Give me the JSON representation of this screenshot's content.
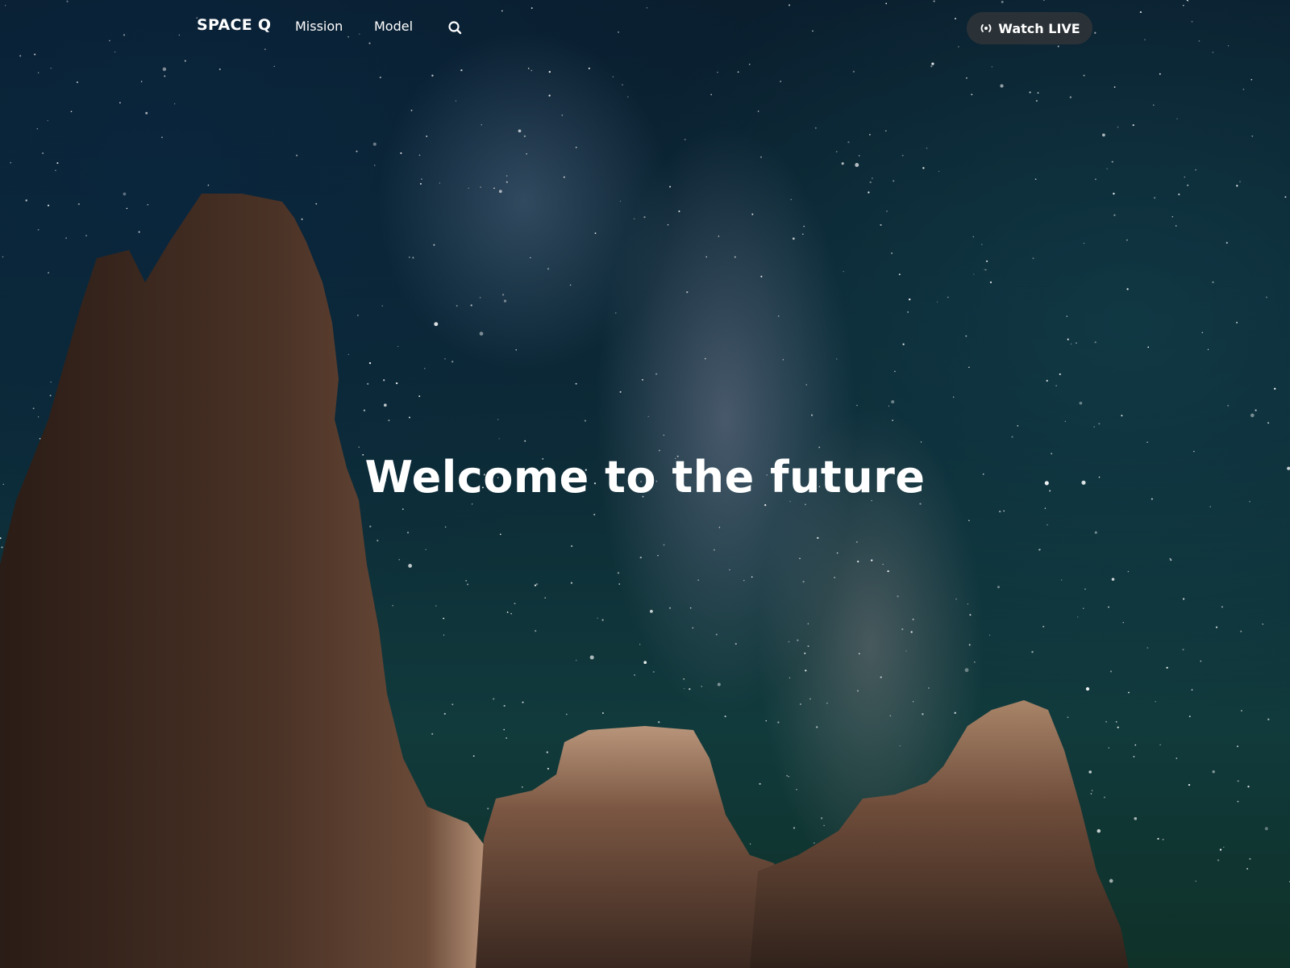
{
  "nav": {
    "brand": "SPACE Q",
    "links": [
      {
        "label": "Mission"
      },
      {
        "label": "Model"
      }
    ],
    "search_icon": "search-icon",
    "watch_live": {
      "label": "Watch LIVE",
      "icon": "live-broadcast-icon"
    }
  },
  "hero": {
    "headline": "Welcome to the future",
    "background": "night-sky-milky-way-rock-spires"
  },
  "colors": {
    "text": "#ffffff",
    "button_bg": "#303438",
    "sky": "#0c2a36",
    "rock": "#6b4a38"
  }
}
